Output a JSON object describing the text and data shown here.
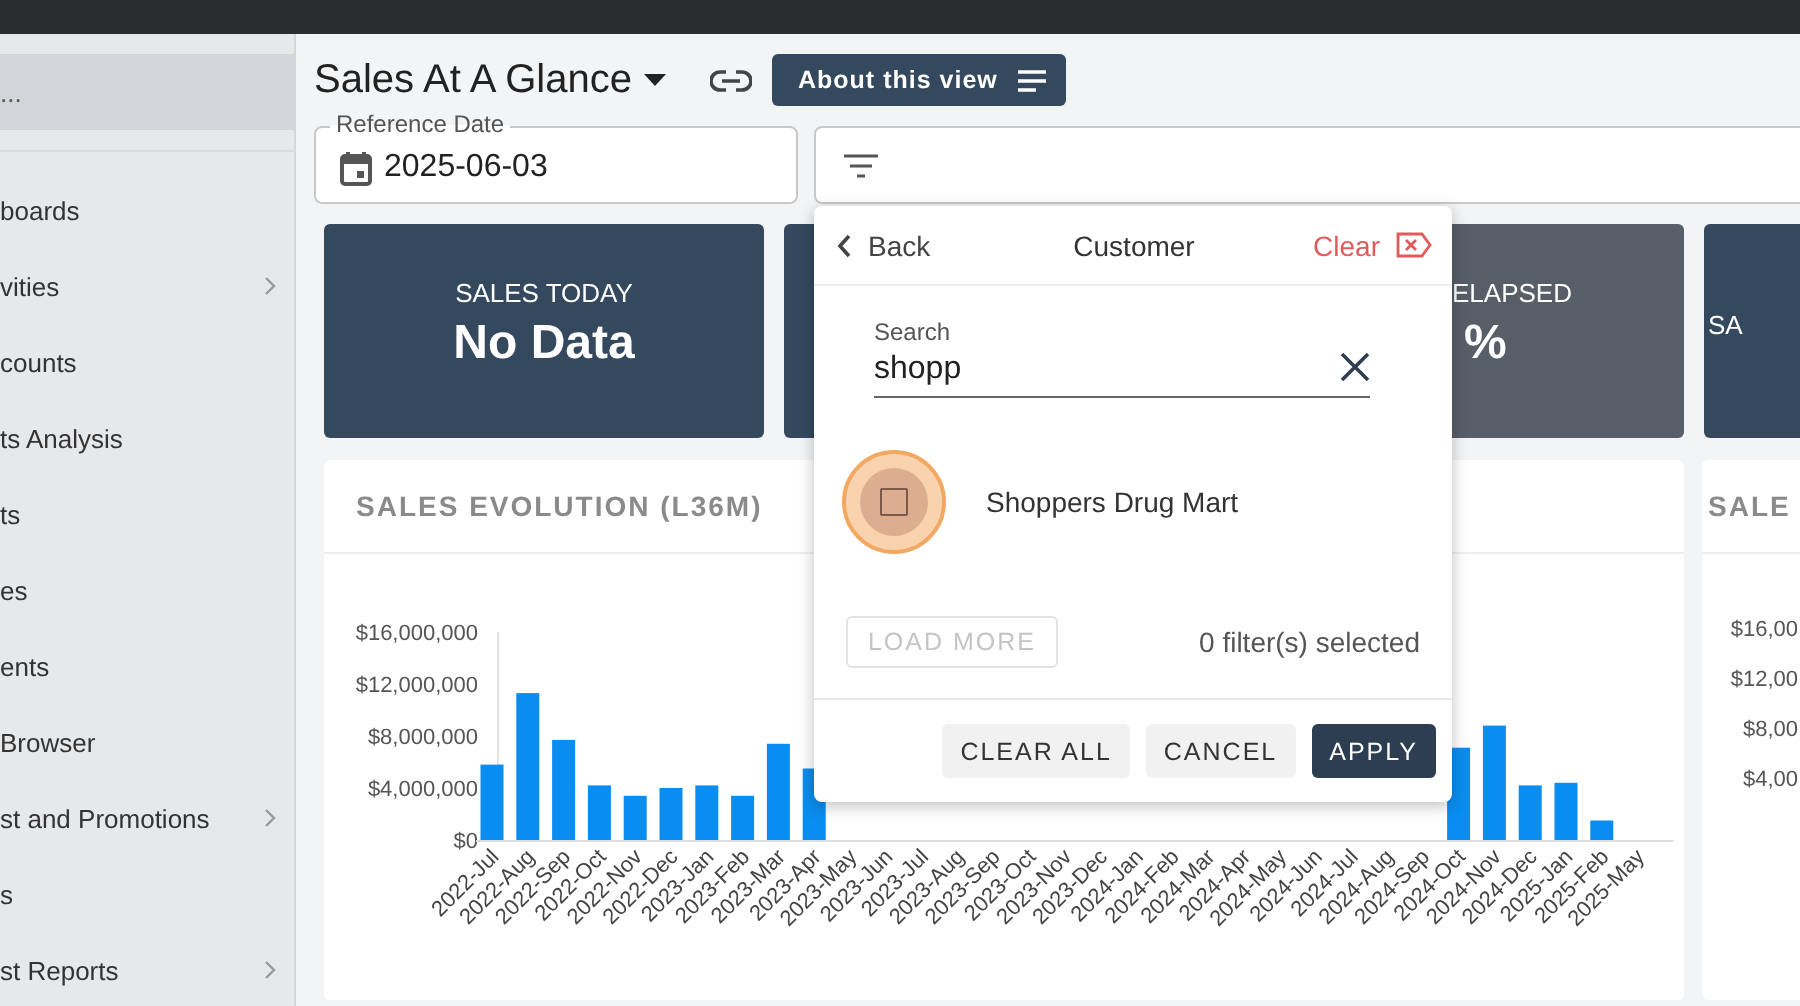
{
  "sidebar": {
    "items": [
      {
        "label": "...",
        "selected": true,
        "has_submenu": false
      },
      {
        "label": "boards",
        "selected": false,
        "has_submenu": false
      },
      {
        "label": "vities",
        "selected": false,
        "has_submenu": true
      },
      {
        "label": "counts",
        "selected": false,
        "has_submenu": false
      },
      {
        "label": "ts Analysis",
        "selected": false,
        "has_submenu": false
      },
      {
        "label": "ts",
        "selected": false,
        "has_submenu": false
      },
      {
        "label": "es",
        "selected": false,
        "has_submenu": false
      },
      {
        "label": "ents",
        "selected": false,
        "has_submenu": false
      },
      {
        "label": "Browser",
        "selected": false,
        "has_submenu": false
      },
      {
        "label": "st and Promotions",
        "selected": false,
        "has_submenu": true
      },
      {
        "label": "s",
        "selected": false,
        "has_submenu": false
      },
      {
        "label": "st Reports",
        "selected": false,
        "has_submenu": true
      }
    ]
  },
  "header": {
    "title": "Sales At A Glance",
    "about_button": "About this view"
  },
  "reference_date": {
    "label": "Reference Date",
    "value": "2025-06-03"
  },
  "kpi_cards": [
    {
      "label": "SALES TODAY",
      "value": "No Data",
      "color": "#34495e"
    },
    {
      "color": "#34495e"
    },
    {
      "label": "ELAPSED",
      "value": "%",
      "color": "#575e68"
    },
    {
      "label": "SA",
      "color": "#34495e"
    }
  ],
  "charts": [
    {
      "title": "SALES EVOLUTION (L36M)",
      "chart_data": {
        "type": "bar",
        "categories": [
          "2022-Jul",
          "2022-Aug",
          "2022-Sep",
          "2022-Oct",
          "2022-Nov",
          "2022-Dec",
          "2023-Jan",
          "2023-Feb",
          "2023-Mar",
          "2023-Apr",
          "2023-May",
          "2023-Jun",
          "2023-Jul",
          "2023-Aug",
          "2023-Sep",
          "2023-Oct",
          "2023-Nov",
          "2023-Dec",
          "2024-Jan",
          "2024-Feb",
          "2024-Mar",
          "2024-Apr",
          "2024-May",
          "2024-Jun",
          "2024-Jul",
          "2024-Aug",
          "2024-Sep",
          "2024-Oct",
          "2024-Nov",
          "2024-Dec",
          "2025-Jan",
          "2025-Feb",
          "2025-May"
        ],
        "values": [
          5800000,
          11300000,
          7700000,
          4200000,
          3400000,
          4000000,
          4200000,
          3400000,
          7400000,
          5500000,
          null,
          null,
          null,
          null,
          null,
          null,
          null,
          null,
          null,
          null,
          null,
          null,
          null,
          null,
          null,
          null,
          null,
          7100000,
          8800000,
          4200000,
          4400000,
          1500000,
          0
        ],
        "ylim": [
          0,
          16000000
        ],
        "yticks": [
          {
            "value": 0,
            "label": "$0"
          },
          {
            "value": 4000000,
            "label": "$4,000,000"
          },
          {
            "value": 8000000,
            "label": "$8,000,000"
          },
          {
            "value": 12000000,
            "label": "$12,000,000"
          },
          {
            "value": 16000000,
            "label": "$16,000,000"
          }
        ]
      }
    },
    {
      "title": "SALE",
      "axis_labels": [
        "$16,00",
        "$12,00",
        "$8,00",
        "$4,00"
      ]
    }
  ],
  "filter_popup": {
    "back": "Back",
    "title": "Customer",
    "clear": "Clear",
    "search_label": "Search",
    "search_value": "shopp",
    "options": [
      {
        "label": "Shoppers Drug Mart",
        "checked": false,
        "focused": true
      }
    ],
    "load_more": {
      "label": "LOAD MORE",
      "disabled": true
    },
    "selection_count": "0 filter(s) selected",
    "buttons": [
      {
        "label": "CLEAR ALL",
        "kind": "secondary"
      },
      {
        "label": "CANCEL",
        "kind": "secondary"
      },
      {
        "label": "APPLY",
        "kind": "primary"
      }
    ]
  }
}
